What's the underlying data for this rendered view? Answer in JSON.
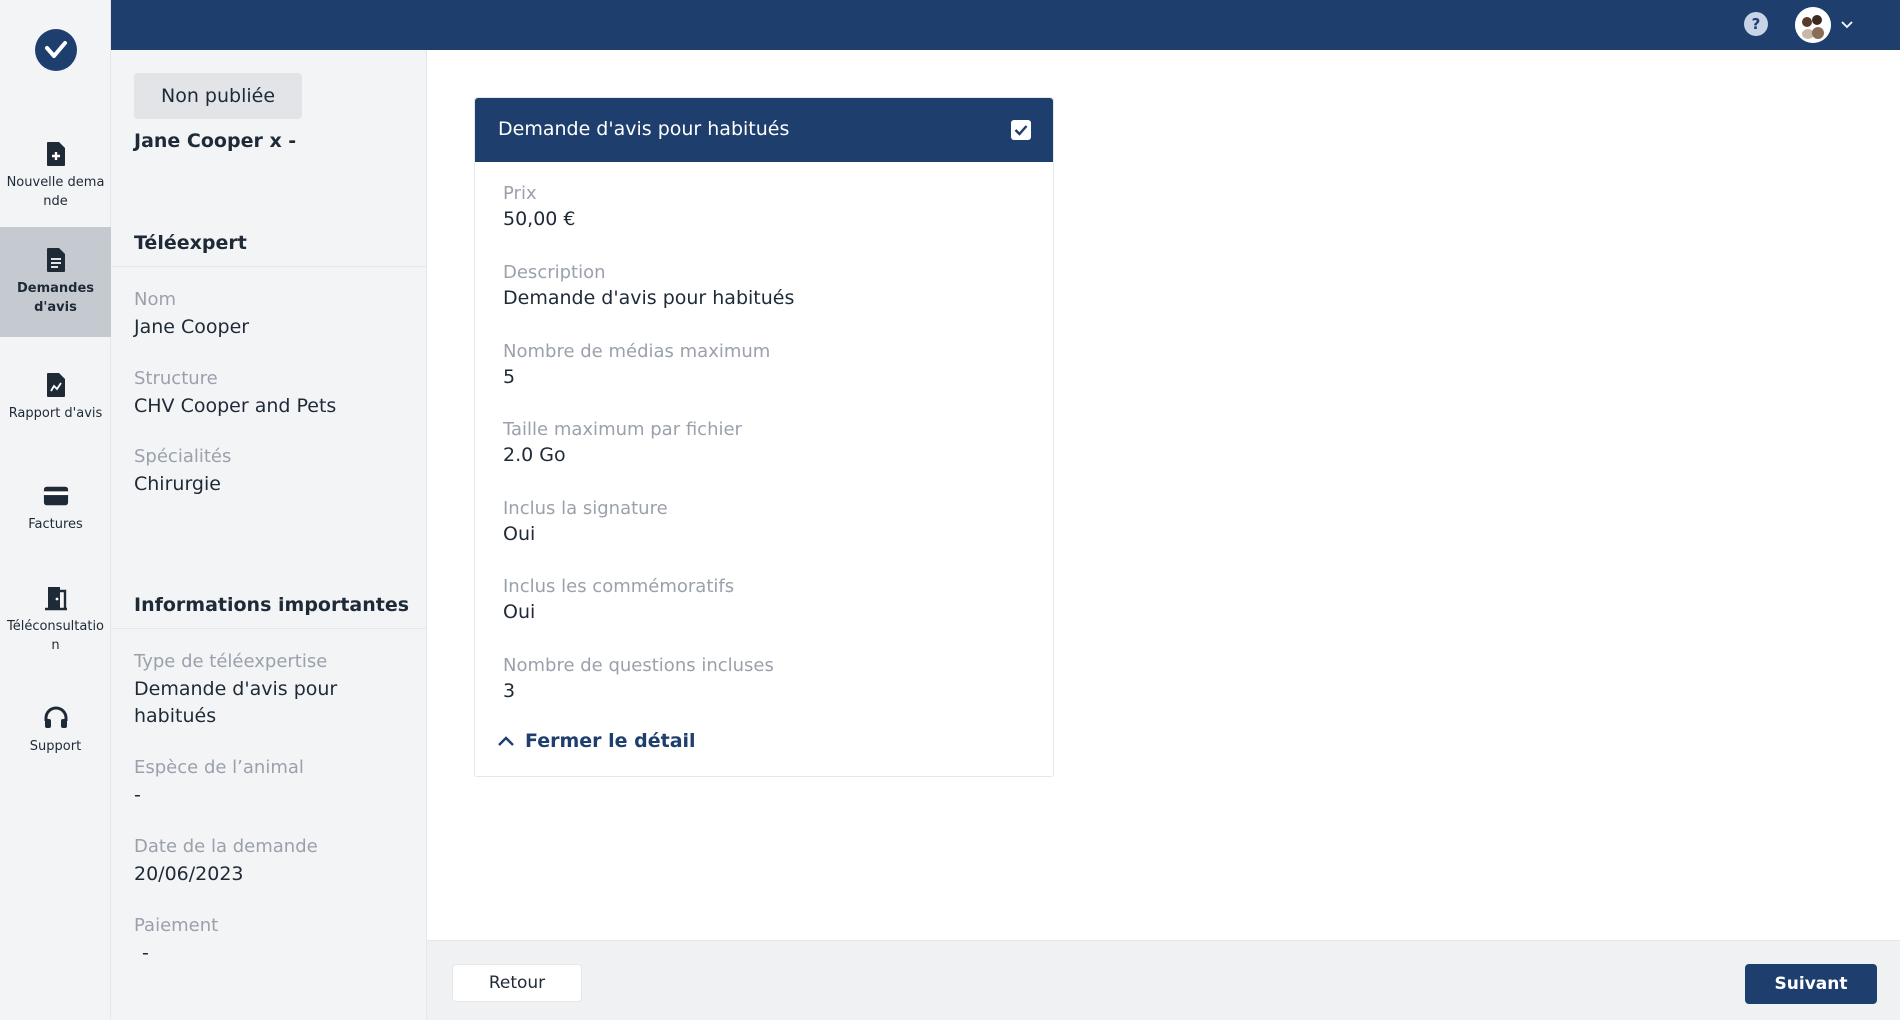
{
  "colors": {
    "brand": "#1e3f6e",
    "sidebar_bg": "#f3f4f6",
    "active_nav_bg": "#c5c9d0",
    "muted_text": "#9aa1ab"
  },
  "sidebar": {
    "logo_icon": "check-logo-icon",
    "items": [
      {
        "label": "Nouvelle demande",
        "icon": "file-plus-icon",
        "active": false
      },
      {
        "label": "Demandes d'avis",
        "icon": "document-icon",
        "active": true
      },
      {
        "label": "Rapport d'avis",
        "icon": "report-icon",
        "active": false
      },
      {
        "label": "Factures",
        "icon": "credit-card-icon",
        "active": false
      },
      {
        "label": "Téléconsultation",
        "icon": "door-exit-icon",
        "active": false
      },
      {
        "label": "Support",
        "icon": "headset-icon",
        "active": false
      }
    ]
  },
  "topbar": {
    "help_label": "?"
  },
  "detail": {
    "status": "Non publiée",
    "client": "Jane Cooper x -",
    "teleexpert": {
      "title": "Téléexpert",
      "name_label": "Nom",
      "name_value": "Jane Cooper",
      "structure_label": "Structure",
      "structure_value": "CHV Cooper and Pets",
      "specialties_label": "Spécialités",
      "specialties_value": "Chirurgie"
    },
    "important": {
      "title": "Informations importantes",
      "type_label": "Type de téléexpertise",
      "type_value": "Demande d'avis pour habitués",
      "species_label": "Espèce de l’animal",
      "species_value": "-",
      "date_label": "Date de la demande",
      "date_value": "20/06/2023",
      "payment_label": "Paiement",
      "payment_value": "-"
    }
  },
  "card": {
    "title": "Demande d'avis pour habitués",
    "checked": true,
    "fields": [
      {
        "label": "Prix",
        "value": "50,00 €"
      },
      {
        "label": "Description",
        "value": "Demande d'avis pour habitués"
      },
      {
        "label": "Nombre de médias maximum",
        "value": "5"
      },
      {
        "label": "Taille maximum par fichier",
        "value": "2.0 Go"
      },
      {
        "label": "Inclus la signature",
        "value": "Oui"
      },
      {
        "label": "Inclus les commémoratifs",
        "value": "Oui"
      },
      {
        "label": "Nombre de questions incluses",
        "value": "3"
      }
    ],
    "close_label": "Fermer le détail"
  },
  "footer": {
    "back_label": "Retour",
    "next_label": "Suivant"
  }
}
